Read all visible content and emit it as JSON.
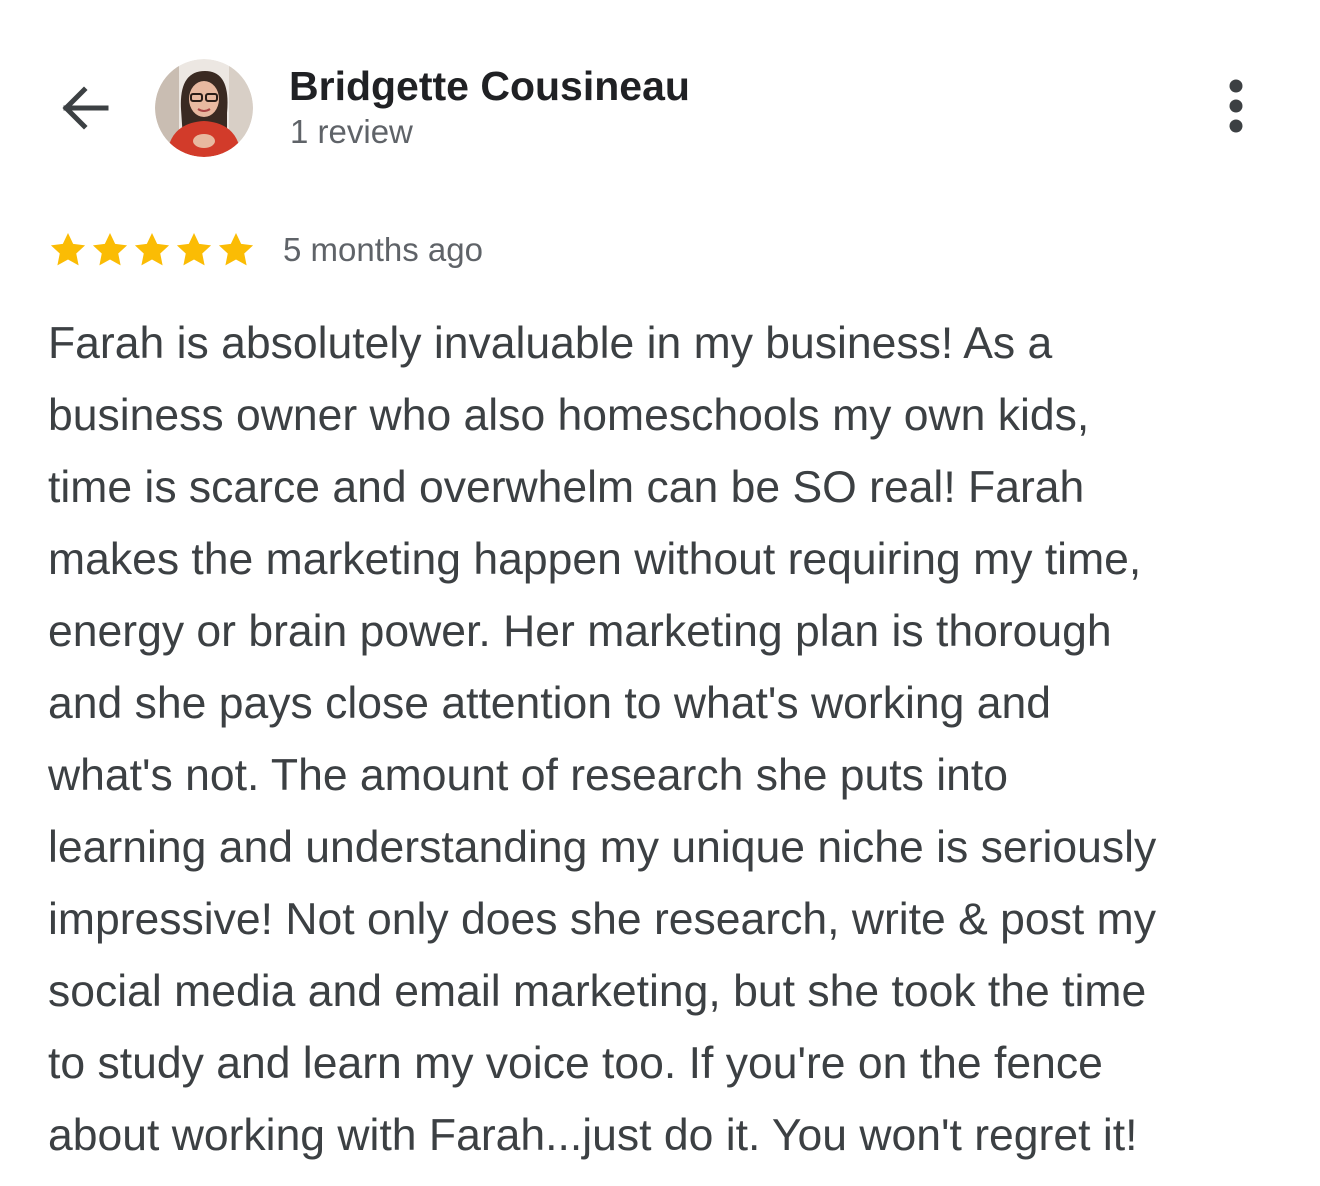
{
  "header": {
    "back_icon": "arrow-left-icon",
    "avatar_icon": "user-avatar",
    "reviewer_name": "Bridgette Cousineau",
    "review_count": "1 review",
    "more_icon": "more-vertical-icon"
  },
  "review": {
    "rating": 5,
    "max_rating": 5,
    "star_color": "#fbbc04",
    "date": "5 months ago",
    "lines": [
      "Farah is absolutely invaluable in my business! As a",
      "business owner who also homeschools my own kids,",
      "time is scarce and overwhelm can be SO real! Farah",
      "makes the marketing happen without requiring my time,",
      "energy or brain power. Her marketing plan is thorough",
      "and she pays close attention to what's working and",
      "what's not. The amount of research she puts into",
      "learning and understanding my unique niche is seriously",
      "impressive! Not only does she research, write & post my",
      "social media and email marketing, but she took the time",
      "to study and learn my voice too. If you're on the fence",
      "about working with Farah...just do it. You won't regret it!"
    ]
  }
}
